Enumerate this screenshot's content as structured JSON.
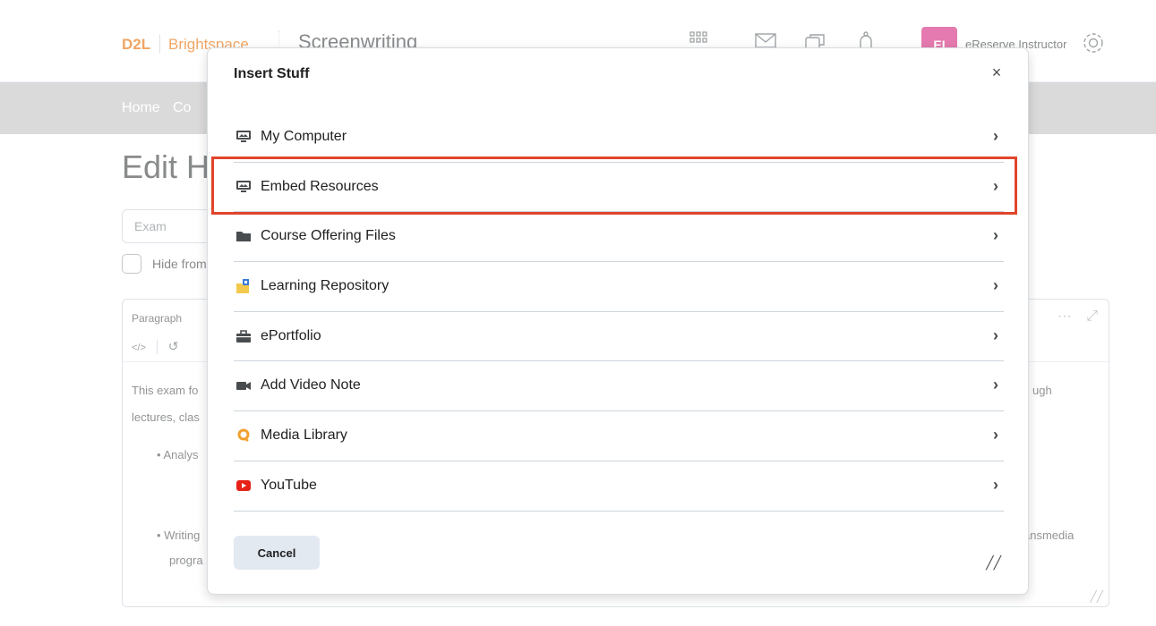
{
  "header": {
    "logo_d2l": "D2L",
    "logo_brightspace": "Brightspace",
    "course_name": "Screenwriting",
    "avatar_initials": "EI",
    "user_name": "eReserve Instructor"
  },
  "nav": {
    "home": "Home",
    "content_partial": "Co"
  },
  "page": {
    "edit_title_partial": "Edit H",
    "exam_placeholder": "Exam",
    "hide_label_partial": "Hide from",
    "editor_format": "Paragraph",
    "editor_line1_start": "This exam fo",
    "editor_line1_end": "ugh",
    "editor_line2_start": "lectures, clas",
    "editor_bullet1": "• Analys",
    "editor_bullet2": "• Writing",
    "editor_bullet2_end": "ansmedia",
    "editor_line_prog": "progra"
  },
  "dialog": {
    "title": "Insert Stuff",
    "close_label": "×",
    "items": [
      {
        "label": "My Computer",
        "icon": "monitor-icon"
      },
      {
        "label": "Embed Resources",
        "icon": "monitor-icon"
      },
      {
        "label": "Course Offering Files",
        "icon": "folder-icon"
      },
      {
        "label": "Learning Repository",
        "icon": "repository-icon"
      },
      {
        "label": "ePortfolio",
        "icon": "briefcase-icon"
      },
      {
        "label": "Add Video Note",
        "icon": "video-camera-icon"
      },
      {
        "label": "Media Library",
        "icon": "media-library-icon"
      },
      {
        "label": "YouTube",
        "icon": "youtube-icon"
      }
    ],
    "cancel_label": "Cancel",
    "highlighted_item": "Embed Resources",
    "highlight_color": "#e0442b"
  }
}
